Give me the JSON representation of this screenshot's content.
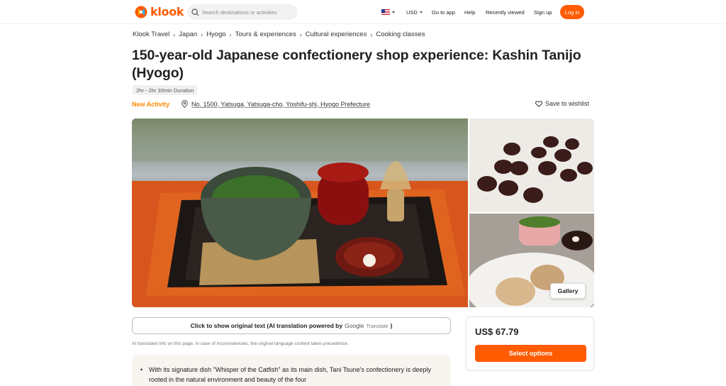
{
  "header": {
    "logo_text": "klook",
    "search_placeholder": "Search destinations or activities",
    "currency": "USD",
    "go_to_app": "Go to app",
    "help": "Help",
    "recently_viewed": "Recently viewed",
    "sign_up": "Sign up",
    "log_in": "Log in",
    "brand_color": "#ff5b00"
  },
  "breadcrumb": [
    "Klook Travel",
    "Japan",
    "Hyogo",
    "Tours & experiences",
    "Cultural experiences",
    "Cooking classes"
  ],
  "activity": {
    "title": "150-year-old Japanese confectionery shop experience: Kashin Tanijo (Hyogo)",
    "duration": "2hr - 2hr 30min Duration",
    "badge": "New Activity",
    "address": "No. 1500, Yatsuga, Yatsuga-cho, Yoshifu-shi, Hyogo Prefecture",
    "wishlist": "Save to wishlist"
  },
  "gallery": {
    "button": "Gallery"
  },
  "translation": {
    "button_prefix": "Click to show original text (AI translation powered by",
    "google": "Google",
    "translate": "Translate",
    "button_suffix": ")",
    "note": "AI translated info on this page. In case of inconsistencies, the original language content takes precedence."
  },
  "highlights": [
    "With its signature dish \"Whisper of the Catfish\" as its main dish, Tani Tsune's confectionery is deeply rooted in the natural environment and beauty of the four"
  ],
  "booking": {
    "price": "US$ 67.79",
    "select_button": "Select options"
  }
}
